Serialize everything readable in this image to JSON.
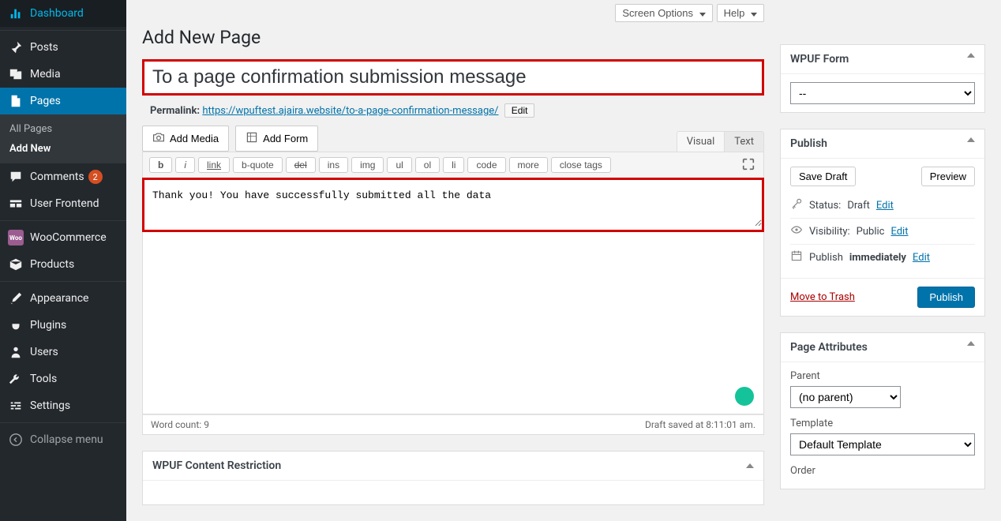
{
  "top": {
    "screen_options": "Screen Options",
    "help": "Help"
  },
  "page": {
    "heading": "Add New Page",
    "title_value": "To a page confirmation submission message",
    "permalink_label": "Permalink:",
    "permalink_url": "https://wpuftest.ajaira.website/to-a-page-confirmation-message/",
    "edit_btn": "Edit"
  },
  "editor": {
    "add_media": "Add Media",
    "add_form": "Add Form",
    "tab_visual": "Visual",
    "tab_text": "Text",
    "qt": {
      "b": "b",
      "i": "i",
      "link": "link",
      "bquote": "b-quote",
      "del": "del",
      "ins": "ins",
      "img": "img",
      "ul": "ul",
      "ol": "ol",
      "li": "li",
      "code": "code",
      "more": "more",
      "close": "close tags"
    },
    "content": "Thank you! You have successfully submitted all the data",
    "word_count_label": "Word count:",
    "word_count": "9",
    "draft_saved": "Draft saved at 8:11:01 am."
  },
  "metabox": {
    "content_restriction": "WPUF Content Restriction"
  },
  "wpuf": {
    "title": "WPUF Form",
    "selected": "--"
  },
  "publish": {
    "title": "Publish",
    "save_draft": "Save Draft",
    "preview": "Preview",
    "status_label": "Status:",
    "status_value": "Draft",
    "visibility_label": "Visibility:",
    "visibility_value": "Public",
    "publish_label": "Publish",
    "publish_value": "immediately",
    "edit": "Edit",
    "trash": "Move to Trash",
    "publish_btn": "Publish"
  },
  "attrs": {
    "title": "Page Attributes",
    "parent_label": "Parent",
    "parent_value": "(no parent)",
    "template_label": "Template",
    "template_value": "Default Template",
    "order_label": "Order"
  },
  "sidebar": {
    "dashboard": "Dashboard",
    "posts": "Posts",
    "media": "Media",
    "pages": "Pages",
    "all_pages": "All Pages",
    "add_new": "Add New",
    "comments": "Comments",
    "comments_count": "2",
    "user_frontend": "User Frontend",
    "woocommerce": "WooCommerce",
    "products": "Products",
    "appearance": "Appearance",
    "plugins": "Plugins",
    "users": "Users",
    "tools": "Tools",
    "settings": "Settings",
    "collapse": "Collapse menu"
  }
}
